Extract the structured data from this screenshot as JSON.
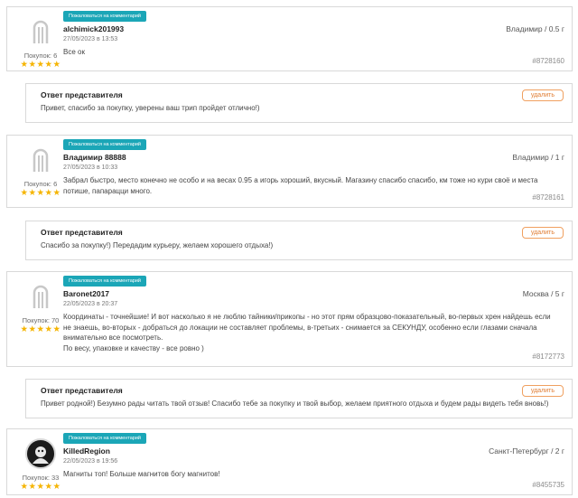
{
  "complain_label": "Пожаловаться на комментарий",
  "reply_title": "Ответ представителя",
  "delete_label": "удалить",
  "reviews": [
    {
      "author": "alchimick201993",
      "date": "27/05/2023 в 13:53",
      "location": "Владимир / 0.5 г",
      "purchases": "Покупок: 6",
      "rating": 5,
      "stars": "★★★★★",
      "avatar": "default-avatar-icon",
      "text": "Все ок",
      "order_id": "#8728160",
      "reply": "Привет, спасибо за покупку, уверены ваш трип пройдет отлично!)"
    },
    {
      "author": "Владимир 88888",
      "date": "27/05/2023 в 10:33",
      "location": "Владимир / 1 г",
      "purchases": "Покупок: 6",
      "rating": 5,
      "stars": "★★★★★",
      "avatar": "default-avatar-icon",
      "text": "Забрал быстро, место конечно не особо и на весах 0.95 а игорь хороший, вкусный. Магазину спасибо спасибо, км тоже но кури своё и места потише, папарацци много.",
      "order_id": "#8728161",
      "reply": "Спасибо за покупку!) Передадим курьеру, желаем хорошего отдыха!)"
    },
    {
      "author": "Baronet2017",
      "date": "22/05/2023 в 20:37",
      "location": "Москва / 5 г",
      "purchases": "Покупок: 70",
      "rating": 5,
      "stars": "★★★★★",
      "avatar": "default-avatar-icon",
      "text": "Координаты - точнейшие! И вот насколько я не люблю тайники/прикопы - но этот прям образцово-показательный, во-первых хрен найдешь если не знаешь, во-вторых - добраться до локации не составляет проблемы, в-третьих - снимается за СЕКУНДУ, особенно если глазами сначала внимательно все посмотреть.\nПо весу, упаковке и качеству - все ровно )",
      "order_id": "#8172773",
      "reply": "Привет родной!) Безумно рады читать твой отзыв! Спасибо тебе за покупку и твой выбор, желаем приятного отдыха и будем рады видеть тебя вновь!)"
    },
    {
      "author": "KilledRegion",
      "date": "22/05/2023 в 19:56",
      "location": "Санкт-Петербург / 2 г",
      "purchases": "Покупок: 33",
      "rating": 5,
      "stars": "★★★★★",
      "avatar": "user-photo-avatar",
      "text": "Магниты топ! Больше магнитов богу магнитов!",
      "order_id": "#8455735",
      "reply": null
    }
  ]
}
